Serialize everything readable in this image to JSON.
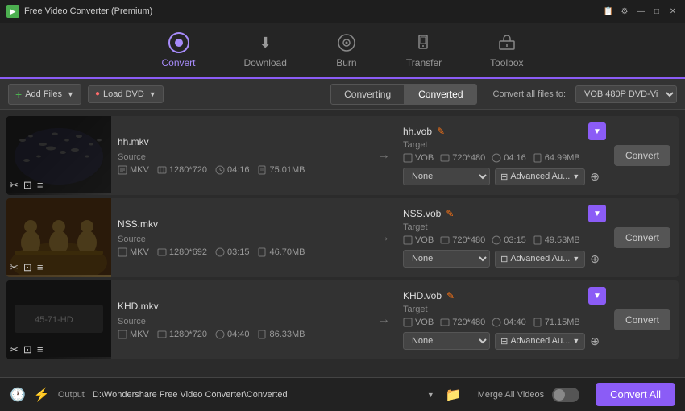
{
  "titleBar": {
    "title": "Free Video Converter (Premium)",
    "icon": "▶"
  },
  "nav": {
    "items": [
      {
        "id": "convert",
        "label": "Convert",
        "icon": "⭕",
        "active": true
      },
      {
        "id": "download",
        "label": "Download",
        "icon": "⬇"
      },
      {
        "id": "burn",
        "label": "Burn",
        "icon": "💿"
      },
      {
        "id": "transfer",
        "label": "Transfer",
        "icon": "📱"
      },
      {
        "id": "toolbox",
        "label": "Toolbox",
        "icon": "🔧"
      }
    ]
  },
  "toolbar": {
    "addFiles": "Add Files",
    "loadDVD": "Load DVD",
    "tabConverting": "Converting",
    "tabConverted": "Converted",
    "convertAllLabel": "Convert all files to:",
    "convertAllValue": "VOB 480P DVD-Vi"
  },
  "files": [
    {
      "id": "hh",
      "sourceName": "hh.mkv",
      "targetName": "hh.vob",
      "thumbType": "birds",
      "source": {
        "format": "MKV",
        "resolution": "1280*720",
        "duration": "04:16",
        "size": "75.01MB"
      },
      "target": {
        "format": "VOB",
        "resolution": "720*480",
        "duration": "04:16",
        "size": "64.99MB"
      },
      "effect": "None",
      "advanced": "Advanced Au..."
    },
    {
      "id": "nss",
      "sourceName": "NSS.mkv",
      "targetName": "NSS.vob",
      "thumbType": "people",
      "source": {
        "format": "MKV",
        "resolution": "1280*692",
        "duration": "03:15",
        "size": "46.70MB"
      },
      "target": {
        "format": "VOB",
        "resolution": "720*480",
        "duration": "03:15",
        "size": "49.53MB"
      },
      "effect": "None",
      "advanced": "Advanced Au..."
    },
    {
      "id": "khd",
      "sourceName": "KHD.mkv",
      "targetName": "KHD.vob",
      "thumbType": "dark",
      "source": {
        "format": "MKV",
        "resolution": "1280*720",
        "duration": "04:40",
        "size": "86.33MB"
      },
      "target": {
        "format": "VOB",
        "resolution": "720*480",
        "duration": "04:40",
        "size": "71.15MB"
      },
      "effect": "None",
      "advanced": "Advanced Au..."
    }
  ],
  "bottomBar": {
    "outputLabel": "Output",
    "outputPath": "D:\\Wondershare Free Video Converter\\Converted",
    "mergeLabel": "Merge All Videos",
    "convertAllBtn": "Convert All"
  },
  "icons": {
    "scissors": "✂",
    "crop": "⊡",
    "list": "≡",
    "arrow": "→",
    "edit": "✎",
    "chevron": "▼",
    "eq": "⊟",
    "clock": "🕐",
    "lightning": "⚡",
    "folder": "📁",
    "minimize": "—",
    "maximize": "□",
    "close": "✕",
    "settings": "⚙",
    "register": "📋"
  }
}
